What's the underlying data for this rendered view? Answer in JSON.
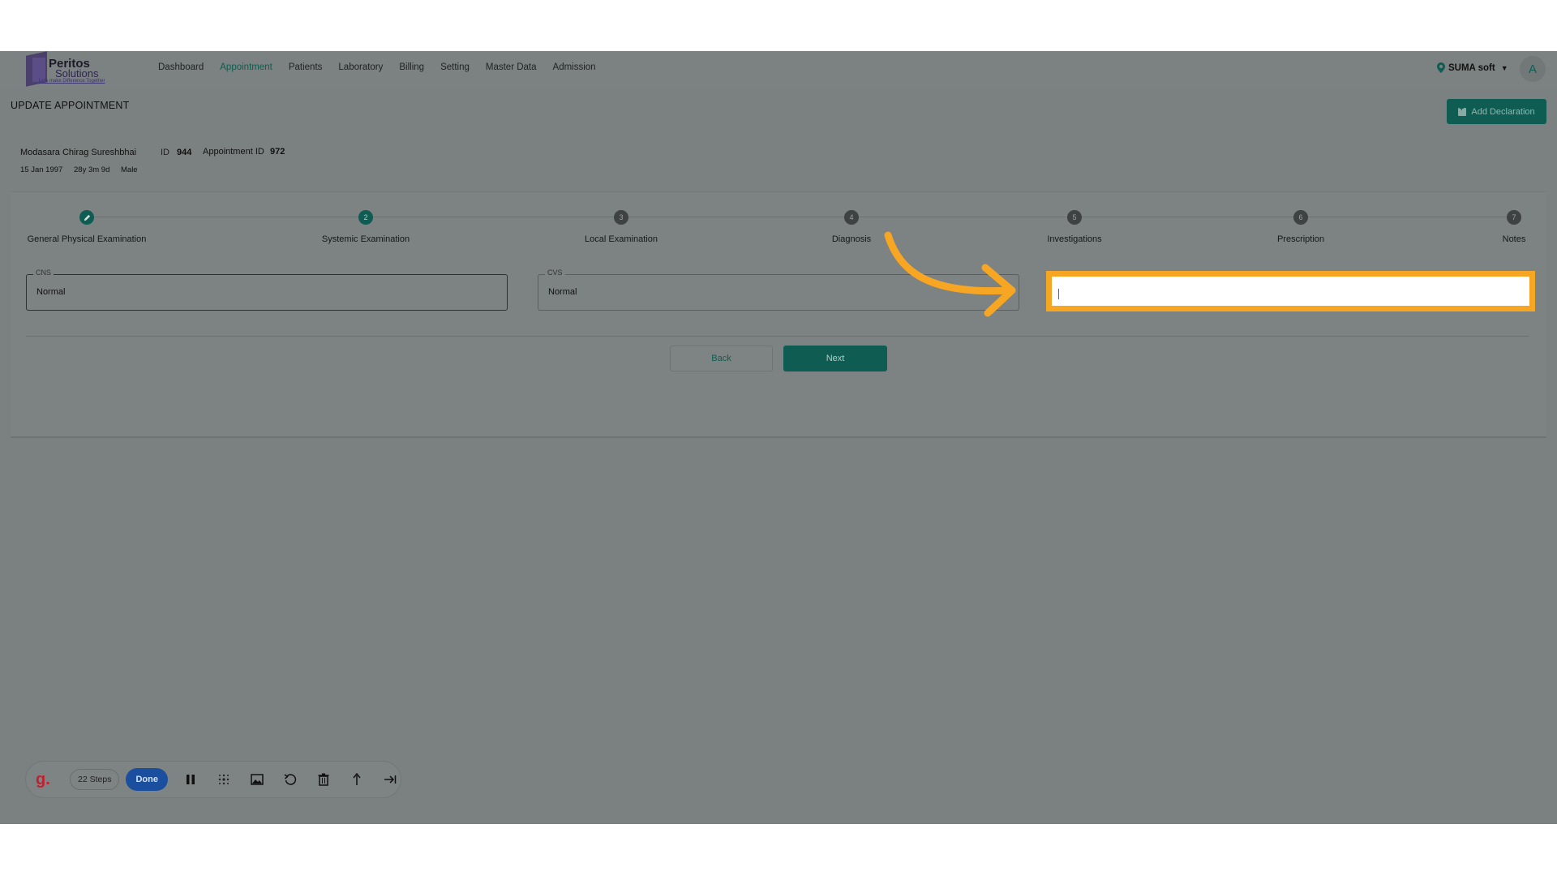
{
  "app": {
    "logo_title": "Peritos",
    "logo_subtitle": "Solutions",
    "logo_tagline": "Lets make Difference Together"
  },
  "nav": {
    "items": [
      "Dashboard",
      "Appointment",
      "Patients",
      "Laboratory",
      "Billing",
      "Setting",
      "Master Data",
      "Admission"
    ],
    "active": "Appointment"
  },
  "header": {
    "location": "SUMA soft",
    "avatar_letter": "A"
  },
  "page": {
    "title": "UPDATE APPOINTMENT",
    "add_declaration_label": "Add Declaration"
  },
  "patient": {
    "name": "Modasara Chirag Sureshbhai",
    "id_label": "ID",
    "id_value": "944",
    "appointment_label": "Appointment ID",
    "appointment_value": "972",
    "dob": "15 Jan 1997",
    "age": "28y 3m 9d",
    "sex": "Male"
  },
  "stepper": {
    "steps": [
      {
        "num": "",
        "label": "General Physical Examination",
        "state": "done"
      },
      {
        "num": "2",
        "label": "Systemic Examination",
        "state": "current"
      },
      {
        "num": "3",
        "label": "Local Examination",
        "state": "pending"
      },
      {
        "num": "4",
        "label": "Diagnosis",
        "state": "pending"
      },
      {
        "num": "5",
        "label": "Investigations",
        "state": "pending"
      },
      {
        "num": "6",
        "label": "Prescription",
        "state": "pending"
      },
      {
        "num": "7",
        "label": "Notes",
        "state": "pending"
      }
    ]
  },
  "form": {
    "cns_label": "CNS",
    "cns_value": "Normal",
    "cvs_label": "CVS",
    "cvs_value": "Normal",
    "highlight_value": ""
  },
  "actions": {
    "back_label": "Back",
    "next_label": "Next"
  },
  "toolbar": {
    "logo": "g.",
    "steps_label": "22 Steps",
    "done_label": "Done",
    "icons": [
      "pause-icon",
      "blur-icon",
      "image-icon",
      "undo-icon",
      "trash-icon",
      "upload-icon",
      "skip-icon"
    ]
  },
  "colors": {
    "accent": "#0f5c52",
    "highlight": "#f6a623",
    "overlay": "#7b8080",
    "done_button": "#1a4fa0"
  }
}
